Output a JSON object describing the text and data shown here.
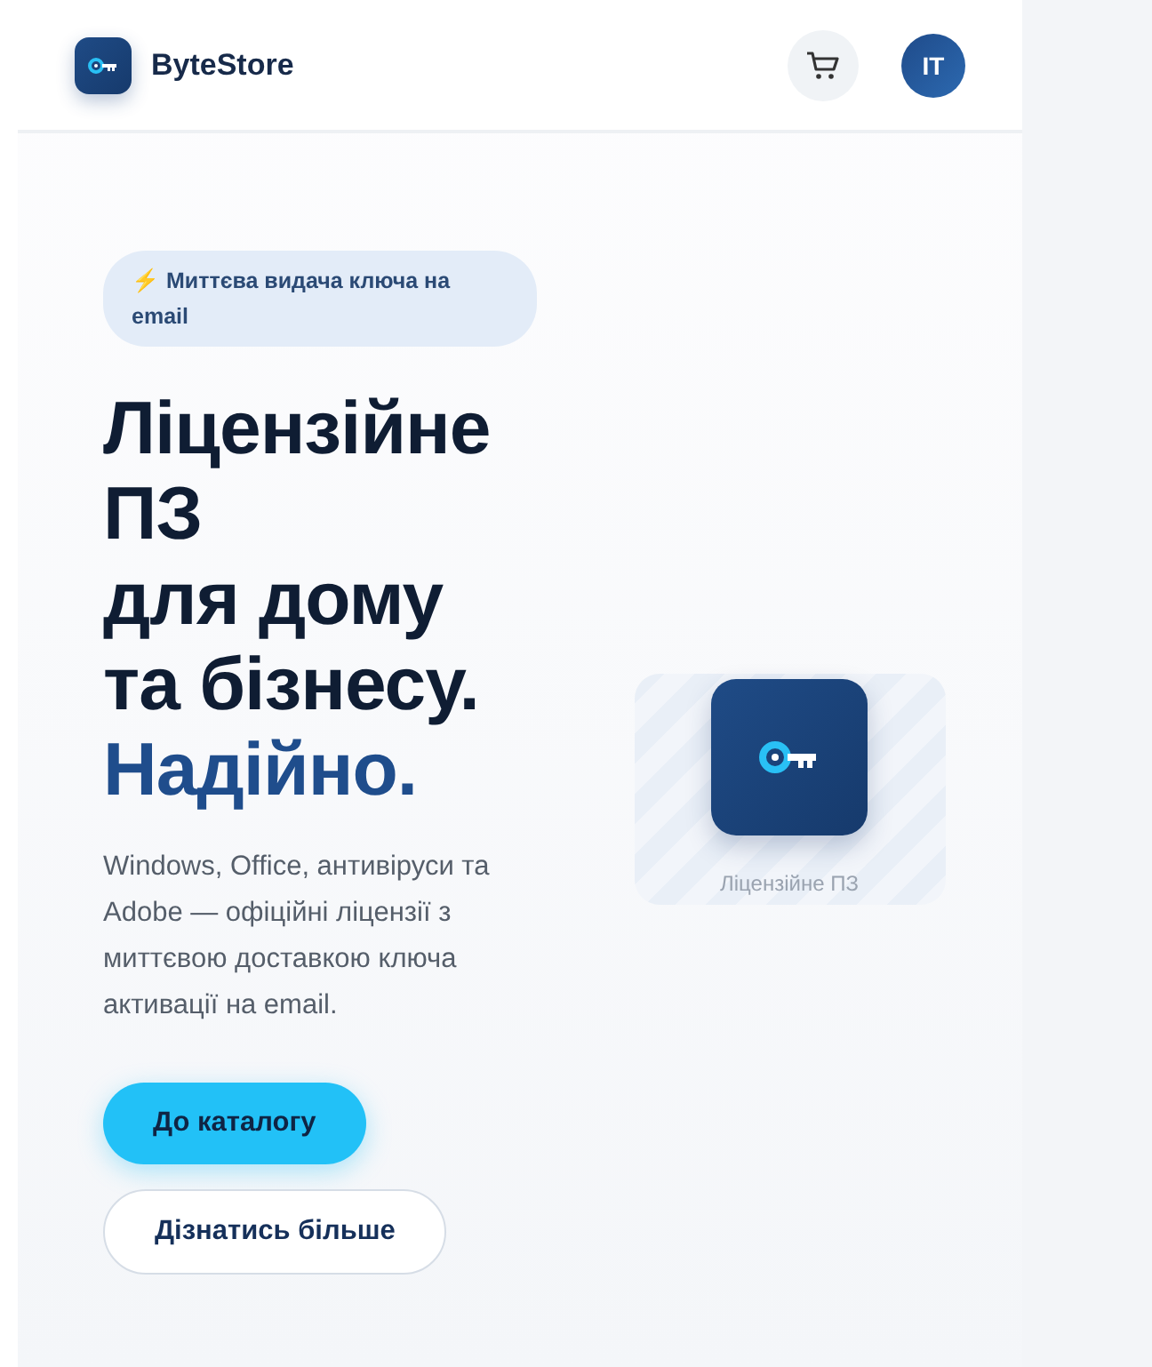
{
  "header": {
    "brand": "ByteStore",
    "avatar": "IT"
  },
  "hero": {
    "badge_icon": "⚡",
    "badge": "Миттєва видача ключа на email",
    "title_lines": [
      "Ліцензійне ПЗ",
      "для дому",
      "та бізнесу."
    ],
    "title_highlight": "Надійно.",
    "description": "Windows, Office, антивіруси та Adobe — офіційні ліцензії з миттєвою доставкою ключа активації на email.",
    "buttons": [
      {
        "label": "До каталогу",
        "kind": "primary"
      },
      {
        "label": "Дізнатись більше",
        "kind": "secondary"
      }
    ],
    "card_caption": "Ліцензійне ПЗ"
  }
}
